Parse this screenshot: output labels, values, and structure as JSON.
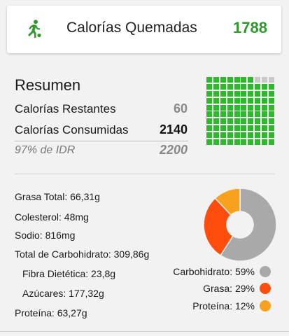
{
  "header": {
    "icon": "running-person-icon",
    "label": "Calorías Quemadas",
    "value": "1788",
    "accent": "#2e9a2e"
  },
  "summary": {
    "title": "Resumen",
    "remaining_label": "Calorías Restantes",
    "remaining_value": "60",
    "consumed_label": "Calorías Consumidas",
    "consumed_value": "2140",
    "rdi_label": "97% de IDR",
    "rdi_value": "2200"
  },
  "waffle": {
    "filled": 97,
    "total": 100,
    "filled_color": "#2eb82e",
    "empty_color": "#c9c9c9"
  },
  "nutrients": {
    "fat": "Grasa Total: 66,31g",
    "cholesterol": "Colesterol: 48mg",
    "sodium": "Sodio: 816mg",
    "carbs": "Total de Carbohidrato: 309,86g",
    "fiber": "Fibra Dietética: 23,8g",
    "sugars": "Azúcares: 177,32g",
    "protein": "Proteína: 63,27g"
  },
  "chart_data": {
    "type": "pie",
    "categories": [
      "Carbohidrato",
      "Grasa",
      "Proteína"
    ],
    "values": [
      59,
      29,
      12
    ],
    "colors": [
      "#a9a9a9",
      "#ff4d0d",
      "#f7a11e"
    ],
    "legend": [
      "Carbohidrato: 59%",
      "Grasa: 29%",
      "Proteína: 12%"
    ]
  }
}
